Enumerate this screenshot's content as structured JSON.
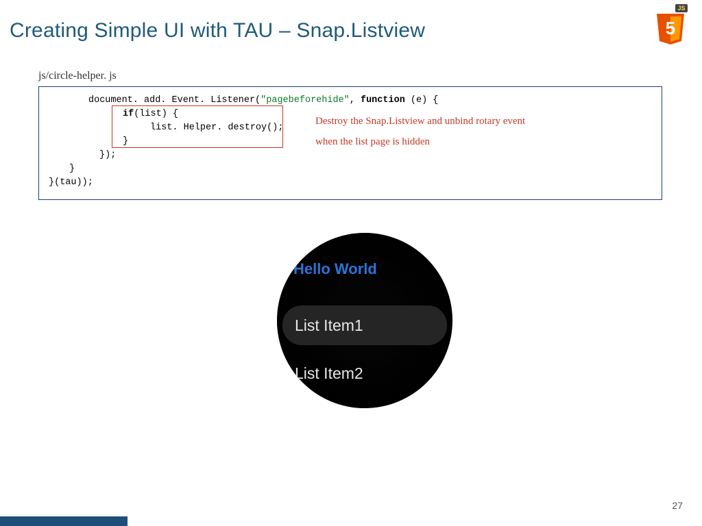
{
  "title": "Creating Simple UI with TAU – Snap.Listview",
  "file_label": "js/circle-helper. js",
  "code": {
    "line1_pre": "document. add. Event. Listener(",
    "line1_str": "\"pagebeforehide\"",
    "line1_mid": ", ",
    "line1_kw": "function",
    "line1_post": " (e) {",
    "line2_kw": "if",
    "line2_post": "(list) {",
    "line3": "list. Helper. destroy();",
    "line4": "}",
    "line5": "});",
    "line6": "}",
    "line7": "}(tau));"
  },
  "annotation": {
    "line1": "Destroy the Snap.Listview and unbind rotary event",
    "line2": "when the list page is hidden"
  },
  "watch": {
    "header": "Hello World",
    "item1": "List Item1",
    "item2": "List Item2"
  },
  "page_number": "27",
  "logo": {
    "badge_text": "JS",
    "five": "5"
  }
}
